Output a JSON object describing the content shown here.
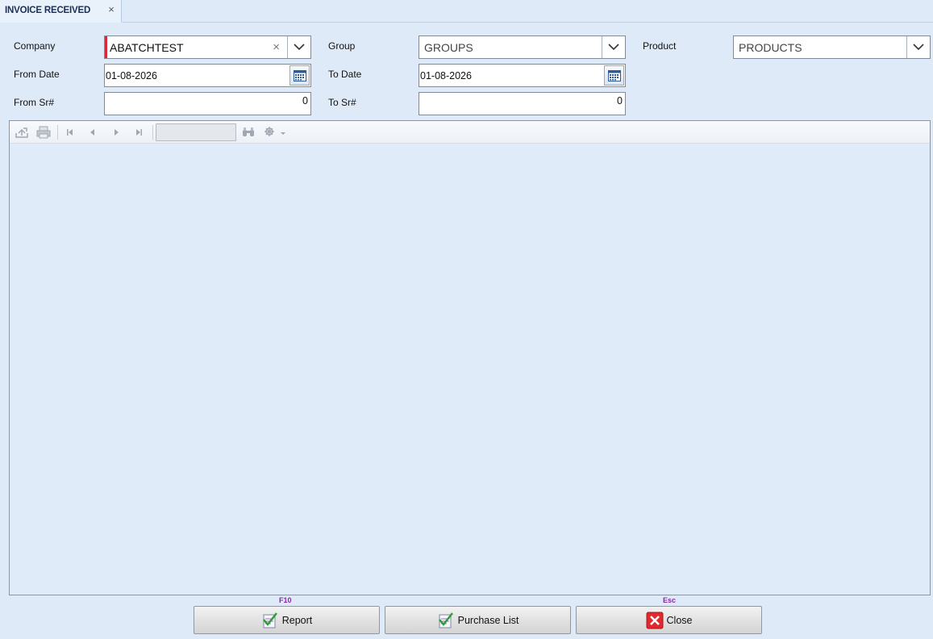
{
  "tab": {
    "title": "INVOICE RECEIVED",
    "close": "×"
  },
  "form": {
    "company": {
      "label": "Company",
      "value": "ABATCHTEST",
      "clear": "×"
    },
    "group": {
      "label": "Group",
      "value": "GROUPS"
    },
    "product": {
      "label": "Product",
      "value": "PRODUCTS"
    },
    "from_date": {
      "label": "From Date",
      "value": "01-08-2026"
    },
    "to_date": {
      "label": "To Date",
      "value": "01-08-2026"
    },
    "from_sr": {
      "label": "From Sr#",
      "value": "0"
    },
    "to_sr": {
      "label": "To Sr#",
      "value": "0"
    }
  },
  "viewer": {
    "toolbar_icons": [
      "export-icon",
      "print-icon",
      "first-page-icon",
      "previous-page-icon",
      "next-page-icon",
      "last-page-icon",
      "find-icon",
      "zoom-icon"
    ],
    "page_number": ""
  },
  "actions": {
    "report": {
      "label": "Report",
      "hotkey": "F10"
    },
    "purchase_list": {
      "label": "Purchase List",
      "hotkey": ""
    },
    "close": {
      "label": "Close",
      "hotkey": "Esc"
    }
  },
  "colors": {
    "background": "#dfeaf8",
    "required_marker": "#d62a3a",
    "hotkey": "#8a2aa8",
    "close_icon": "#e0282e"
  }
}
